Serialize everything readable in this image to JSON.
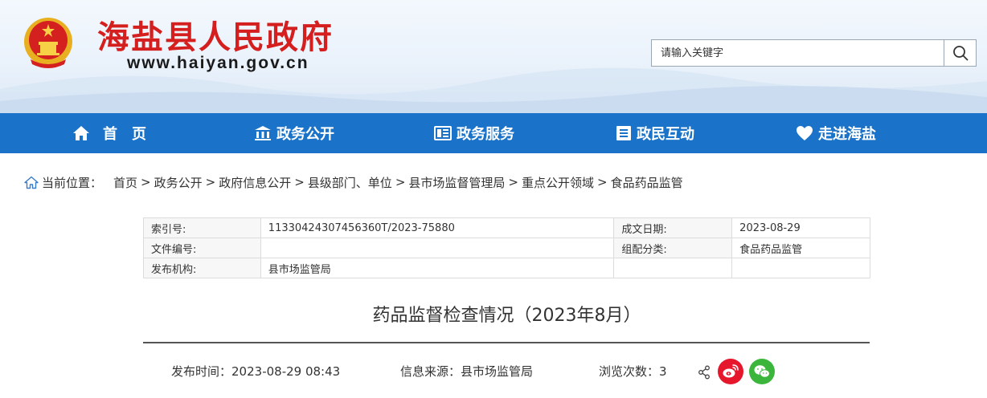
{
  "header": {
    "site_title": "海盐县人民政府",
    "site_url": "www.haiyan.gov.cn",
    "search": {
      "placeholder": "请输入关键字"
    }
  },
  "nav": [
    {
      "label": "首　页",
      "icon": "home-icon"
    },
    {
      "label": "政务公开",
      "icon": "building-icon"
    },
    {
      "label": "政务服务",
      "icon": "service-icon"
    },
    {
      "label": "政民互动",
      "icon": "interaction-icon"
    },
    {
      "label": "走进海盐",
      "icon": "heart-icon"
    }
  ],
  "breadcrumb": {
    "label": "当前位置：",
    "items": [
      "首页",
      "政务公开",
      "政府信息公开",
      "县级部门、单位",
      "县市场监督管理局",
      "重点公开领域",
      "食品药品监管"
    ]
  },
  "info": {
    "index_label": "索引号:",
    "index_value": "11330424307456360T/2023-75880",
    "date_label": "成文日期:",
    "date_value": "2023-08-29",
    "docno_label": "文件编号:",
    "docno_value": "",
    "category_label": "组配分类:",
    "category_value": "食品药品监管",
    "publisher_label": "发布机构:",
    "publisher_value": "县市场监管局"
  },
  "article": {
    "title": "药品监督检查情况（2023年8月）",
    "publish_time_label": "发布时间：",
    "publish_time": "2023-08-29 08:43",
    "source_label": "信息来源：",
    "source": "县市场监管局",
    "views_label": "浏览次数：",
    "views": "3"
  },
  "colors": {
    "brand_red": "#d51e1e",
    "nav_blue": "#1a73c8",
    "weibo": "#e6162d",
    "wechat": "#3bb53b"
  }
}
